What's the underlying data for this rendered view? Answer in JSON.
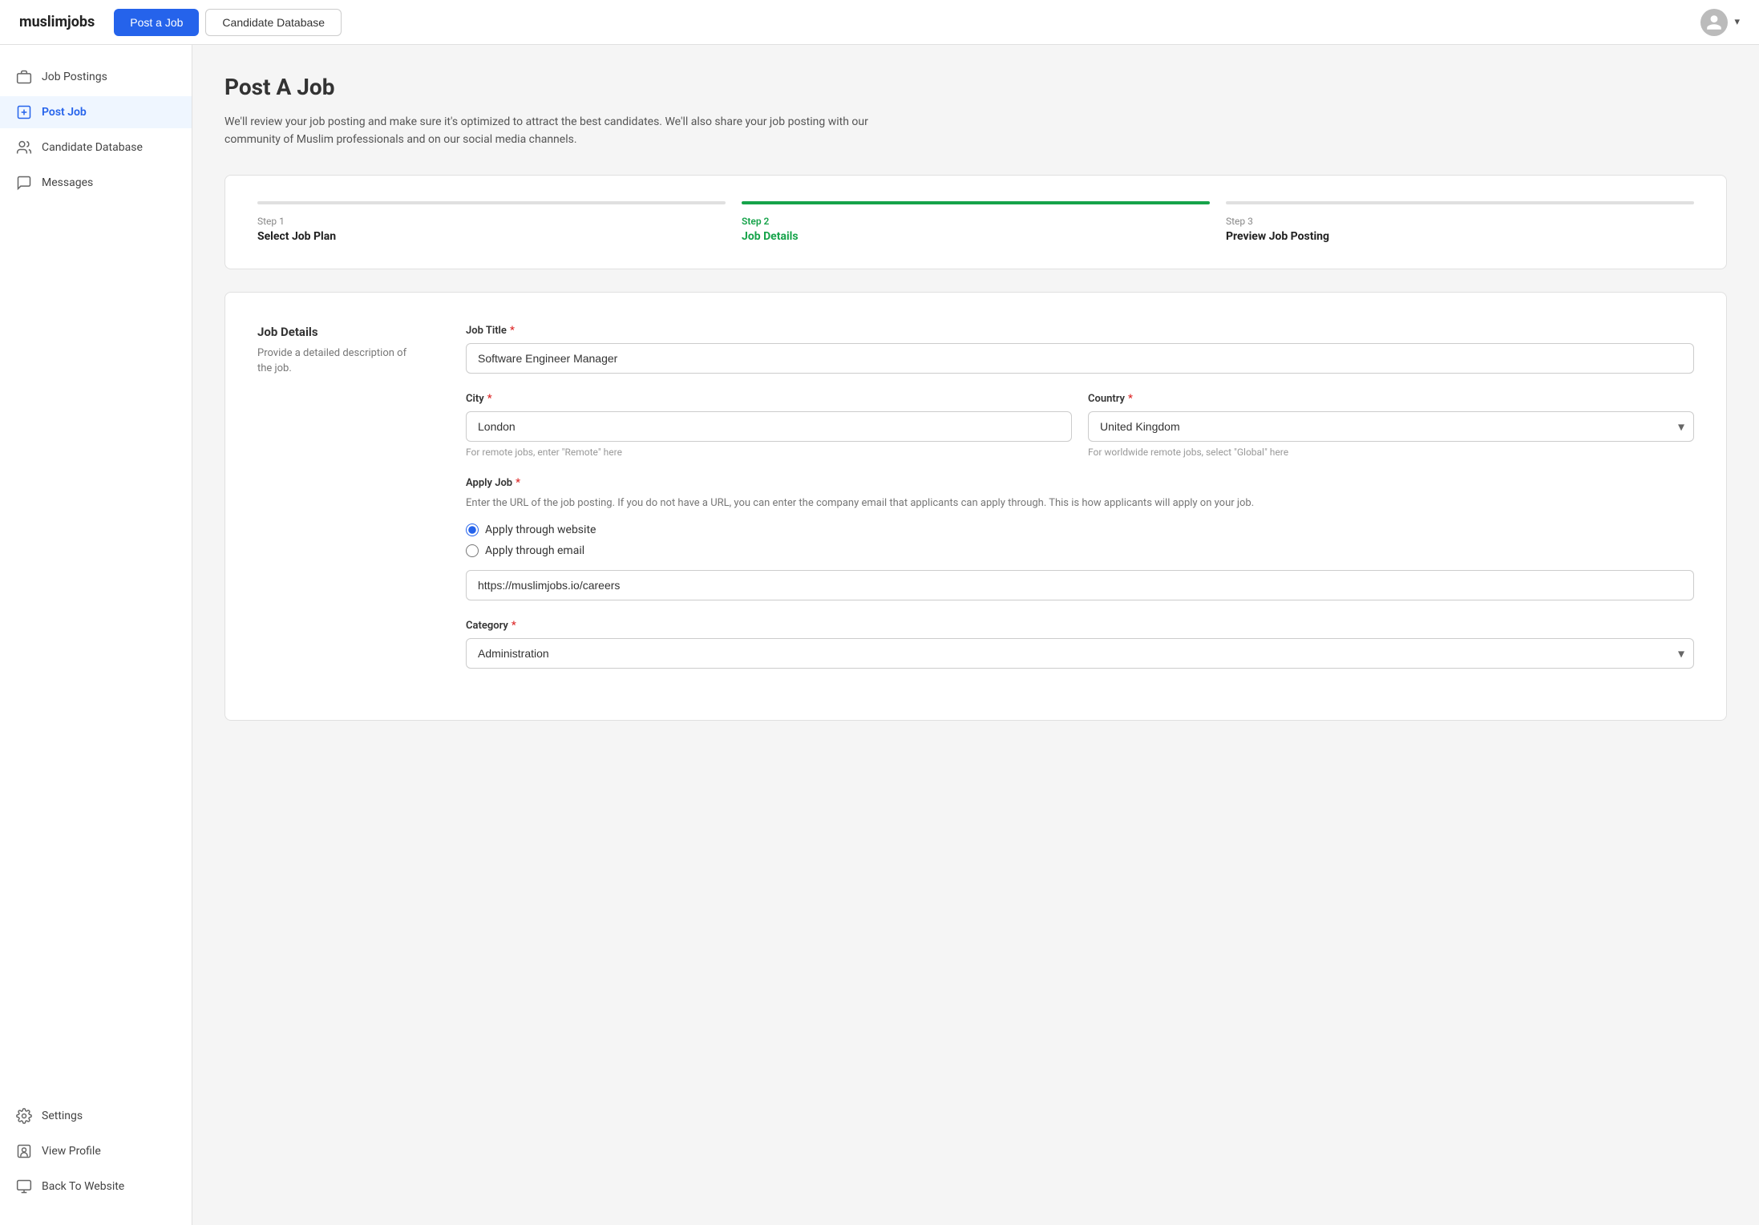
{
  "site": {
    "logo": "muslimjobs"
  },
  "topnav": {
    "post_job_label": "Post a Job",
    "candidate_db_label": "Candidate Database",
    "chevron": "▾"
  },
  "sidebar": {
    "top_items": [
      {
        "id": "job-postings",
        "label": "Job Postings",
        "icon": "briefcase"
      },
      {
        "id": "post-job",
        "label": "Post Job",
        "icon": "post",
        "active": true
      },
      {
        "id": "candidate-database",
        "label": "Candidate Database",
        "icon": "people"
      },
      {
        "id": "messages",
        "label": "Messages",
        "icon": "message"
      }
    ],
    "bottom_items": [
      {
        "id": "settings",
        "label": "Settings",
        "icon": "gear"
      },
      {
        "id": "view-profile",
        "label": "View Profile",
        "icon": "profile"
      },
      {
        "id": "back-to-website",
        "label": "Back To Website",
        "icon": "monitor"
      }
    ]
  },
  "page": {
    "title": "Post A Job",
    "description": "We'll review your job posting and make sure it's optimized to attract the best candidates. We'll also share your job posting with our community of Muslim professionals and on our social media channels."
  },
  "steps": [
    {
      "id": "step1",
      "number": "Step 1",
      "label": "Select Job Plan",
      "state": "inactive"
    },
    {
      "id": "step2",
      "number": "Step 2",
      "label": "Job Details",
      "state": "active"
    },
    {
      "id": "step3",
      "number": "Step 3",
      "label": "Preview Job Posting",
      "state": "inactive"
    }
  ],
  "form": {
    "sidebar_title": "Job Details",
    "sidebar_desc": "Provide a detailed description of the job.",
    "job_title_label": "Job Title",
    "job_title_value": "Software Engineer Manager",
    "city_label": "City",
    "city_value": "London",
    "city_hint": "For remote jobs, enter \"Remote\" here",
    "country_label": "Country",
    "country_value": "United Kingdom",
    "country_hint": "For worldwide remote jobs, select \"Global\" here",
    "apply_job_label": "Apply Job",
    "apply_job_desc": "Enter the URL of the job posting. If you do not have a URL, you can enter the company email that applicants can apply through. This is how applicants will apply on your job.",
    "apply_options": [
      {
        "id": "website",
        "label": "Apply through website",
        "checked": true
      },
      {
        "id": "email",
        "label": "Apply through email",
        "checked": false
      }
    ],
    "apply_url_value": "https://muslimjobs.io/careers",
    "category_label": "Category",
    "category_value": "Administration"
  }
}
